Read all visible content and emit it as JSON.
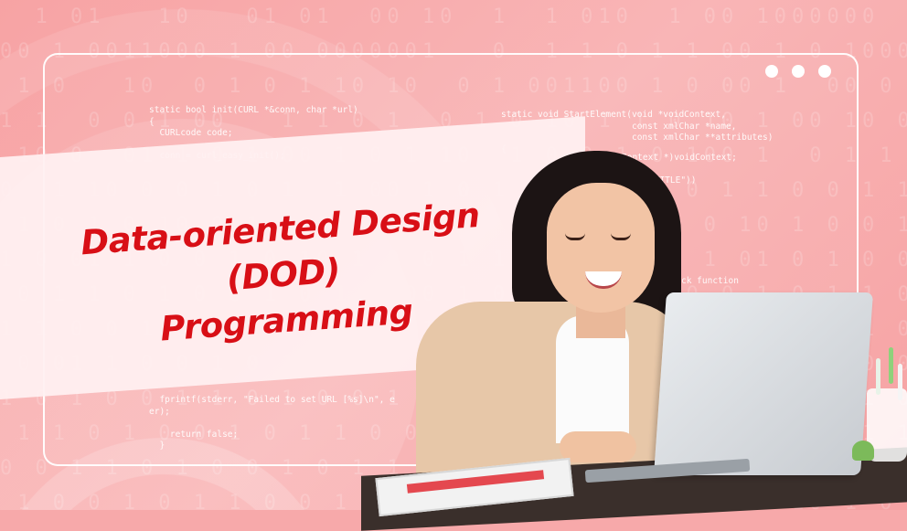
{
  "title": {
    "line1": "Data-oriented Design",
    "line2": "(DOD)",
    "line3": "Programming"
  },
  "code_left": {
    "top": "static bool init(CURL *&conn, char *url)\n{\n  CURLcode code;\n\n  conn = curl_easy_init();",
    "bottom": "  fprintf(stderr, \"Failed to set URL [%s]\\n\", e\ner);\n\n    return false;\n  }"
  },
  "code_right": {
    "top": "static void StartElement(void *voidContext,\n                         const xmlChar *name,\n                         const xmlChar **attributes)\n{",
    "mid1": "Context *)voidContext;",
    "mid2": "\"TITLE\"))",
    "mid3": "ck function"
  },
  "binary_rows": [
    "  1 01   10   01 01  00 10  1  1 010  1 00 1000000  1 01001100 10",
    "00 1 0011000 1 00 0000001   0  1 1 0 1 1 00 1 0 10001 1 00110 1",
    " 1 0   10  0 1 0 1 10 10  0 1 001100 1 0 00 1  00 0   1 10 010 1",
    "1 1  0 0 1 00   1 1 0 1  0 1 0 10 1 1 0 10 1 00 10 01  10 1 1 0 ",
    " 10 0  01 1 0 1 00 1 0 1 10  1 0 0 1 0 100 1  0 1 1 0 011 0 1  1",
    "0  1 10 0 0 1 0 1  1 00 1 0 1 10 0 01  0 1 1 0 0 1 10 0 1 0 0 1 ",
    " 1 0 1 0 10 0 1 0 1 0 0 11 0 1 0 0 1 01 0 10 1 0 0 1 1 0 1 00 1",
    "1 0 01 1 0 0 1 0 10 1 0 0 1 1 0 1 0 0 1 1 01 0 1 0 0 1 1 0 1 0 ",
    " 0 1 1 0 1 0 0 1 0 1 1 00 1 0 1 0 0 1 10 0 1 0 1 1 0 0 10 1 0 1",
    "1 1 0 0 1 0 1 1 0 0 1 0 1 0 01 1 0 0 1 0 1 1 0 0 1 0 1 01 0 1 0",
    " 0 01 1 0 0 1 0 1 1 0 1 0 0 1 0 1 1 0 0 10 1 0 1 0 0 1 1 0 1 0 ",
    "1 0 1 0 0 1 1 0 1 0 0 1 0 1 10 0 1 0 1 0 0 1 1 0 1 00 1 0 1 1 0",
    " 1 1 0 1 0 0 1 0 1 1 0 01 0 1 0 0 1 1 0 1 0 0 1 01 1 0 1 0 0 1 ",
    "0 0 1 1 0 1 0 0 1 0 1 1 0 0 1 0 1 0 01 1 0 1 0 0 1 1 0 1 0 0 1 0",
    " 1 0 0 1 0 1 1 0 0 1 0 1 0 1 0 0 1 1 0 1 0 0 10 1 0 1 1 0 0 1 0 "
  ]
}
